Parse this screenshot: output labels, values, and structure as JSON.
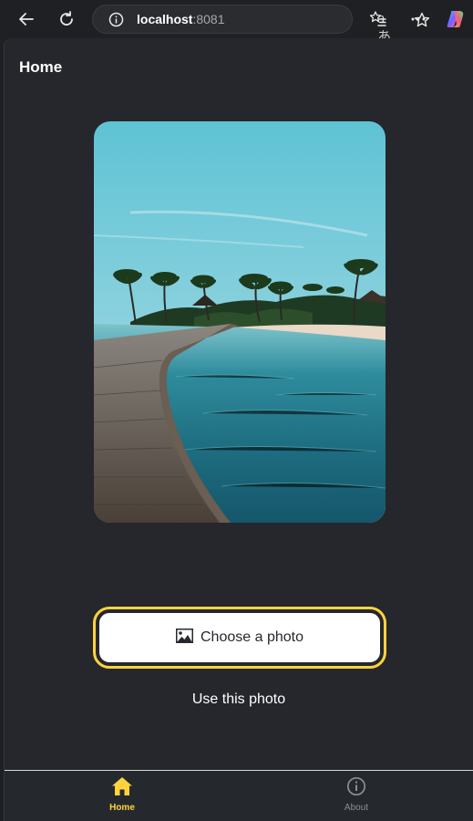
{
  "browser": {
    "host": "localhost",
    "port": ":8081",
    "read_aloud": "aあ"
  },
  "header": {
    "title": "Home"
  },
  "main": {
    "choose_label": "Choose a photo",
    "use_label": "Use this photo"
  },
  "tabs": [
    {
      "label": "Home",
      "active": true
    },
    {
      "label": "About",
      "active": false
    }
  ],
  "colors": {
    "accent": "#ffd33d",
    "background": "#25272c",
    "tab_inactive": "#8d8e91"
  },
  "icons": [
    "back-arrow-icon",
    "refresh-icon",
    "info-icon",
    "star-icon",
    "favorites-icon",
    "more-icon",
    "copilot-icon",
    "image-icon",
    "home-icon",
    "info-circle-icon"
  ]
}
